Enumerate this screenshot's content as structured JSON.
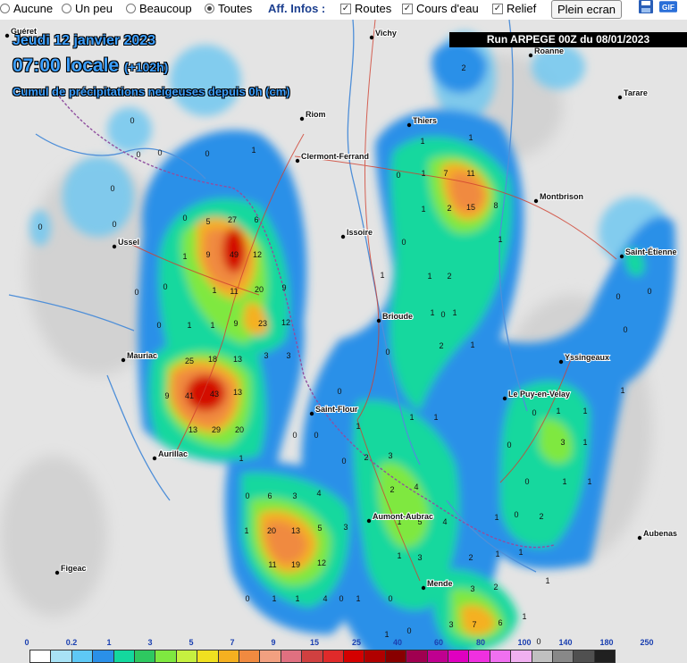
{
  "toolbar": {
    "radios": [
      {
        "label": "Aucune",
        "checked": false
      },
      {
        "label": "Un peu",
        "checked": false
      },
      {
        "label": "Beaucoup",
        "checked": false
      },
      {
        "label": "Toutes",
        "checked": true
      }
    ],
    "infos_label": "Aff. Infos :",
    "checks": [
      {
        "label": "Routes",
        "checked": true
      },
      {
        "label": "Cours d'eau",
        "checked": true
      },
      {
        "label": "Relief",
        "checked": true
      }
    ],
    "fullscreen_label": "Plein ecran",
    "icons": [
      "save-icon",
      "gif-icon"
    ]
  },
  "header": {
    "date": "Jeudi 12 janvier 2023",
    "time": "07:00 locale",
    "offset": "(+102h)",
    "subtitle": "Cumul de précipitations neigeuses depuis 0h (cm)"
  },
  "run_banner": "Run ARPEGE 00Z du 08/01/2023",
  "cities": [
    "Vichy",
    "Roanne",
    "Guéret",
    "Tarare",
    "Riom",
    "Thiers",
    "Clermont-Ferrand",
    "Montbrison",
    "Ussel",
    "Issoire",
    "Saint-Étienne",
    "Brioude",
    "Mauriac",
    "Yssingeaux",
    "Le Puy-en-Velay",
    "Saint-Flour",
    "Aurillac",
    "Aumont-Aubrac",
    "Aubenas",
    "Figeac",
    "Mende"
  ],
  "legend": {
    "values": [
      "0",
      "0.2",
      "1",
      "3",
      "5",
      "7",
      "9",
      "15",
      "25",
      "40",
      "60",
      "80",
      "100",
      "140",
      "180",
      "250"
    ],
    "colors": [
      "#ffffff",
      "#a8e2f5",
      "#5ec8f5",
      "#2a90e8",
      "#14d89e",
      "#2ec860",
      "#7fe840",
      "#c6f040",
      "#f0e020",
      "#f5b020",
      "#f08a40",
      "#f2a080",
      "#e07080",
      "#d04040",
      "#e02a2a",
      "#d40000",
      "#b00000",
      "#880000",
      "#a00050",
      "#c00090",
      "#e000c0",
      "#f030e0",
      "#f070f0",
      "#f0b0f0",
      "#c0c0c0",
      "#888888",
      "#505050",
      "#202020"
    ]
  },
  "precip_values": [
    "0",
    "1",
    "2",
    "3",
    "4",
    "5",
    "6",
    "7",
    "8",
    "9",
    "11",
    "12",
    "13",
    "15",
    "18",
    "19",
    "20",
    "23",
    "25",
    "27",
    "29",
    "41",
    "43",
    "49"
  ],
  "colors": {
    "header_text": "#3da0ff",
    "banner_bg": "#000000"
  }
}
